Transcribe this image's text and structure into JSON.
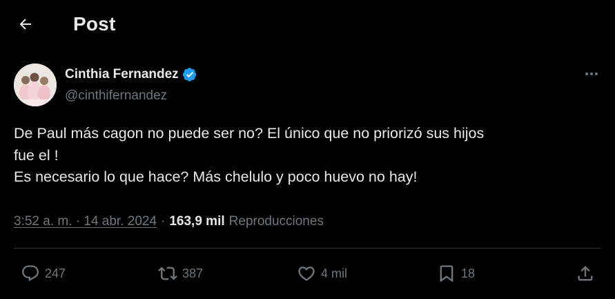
{
  "header": {
    "title": "Post"
  },
  "author": {
    "name": "Cinthia Fernandez",
    "handle": "@cinthifernandez",
    "verified": true
  },
  "post": {
    "lines": [
      "De Paul más cagon no puede ser no? El único que no priorizó sus hijos",
      "fue el !",
      "Es necesario lo que hace? Más chelulo y poco huevo no hay!"
    ],
    "timestamp": "3:52 a. m. · 14 abr. 2024",
    "separator": "·",
    "views_count": "163,9 mil",
    "views_label": "Reproducciones"
  },
  "actions": {
    "replies": "247",
    "reposts": "387",
    "likes": "4 mil",
    "bookmarks": "18"
  },
  "colors": {
    "background": "#000000",
    "text": "#e7e9ea",
    "secondary": "#71767b",
    "verified": "#1d9bf0",
    "divider": "#2f3336"
  },
  "icons": {
    "back": "arrow-left-icon",
    "verified": "verified-badge-icon",
    "more": "more-horizontal-icon",
    "reply": "reply-bubble-icon",
    "repost": "repost-icon",
    "like": "heart-icon",
    "bookmark": "bookmark-icon",
    "share": "share-icon"
  }
}
